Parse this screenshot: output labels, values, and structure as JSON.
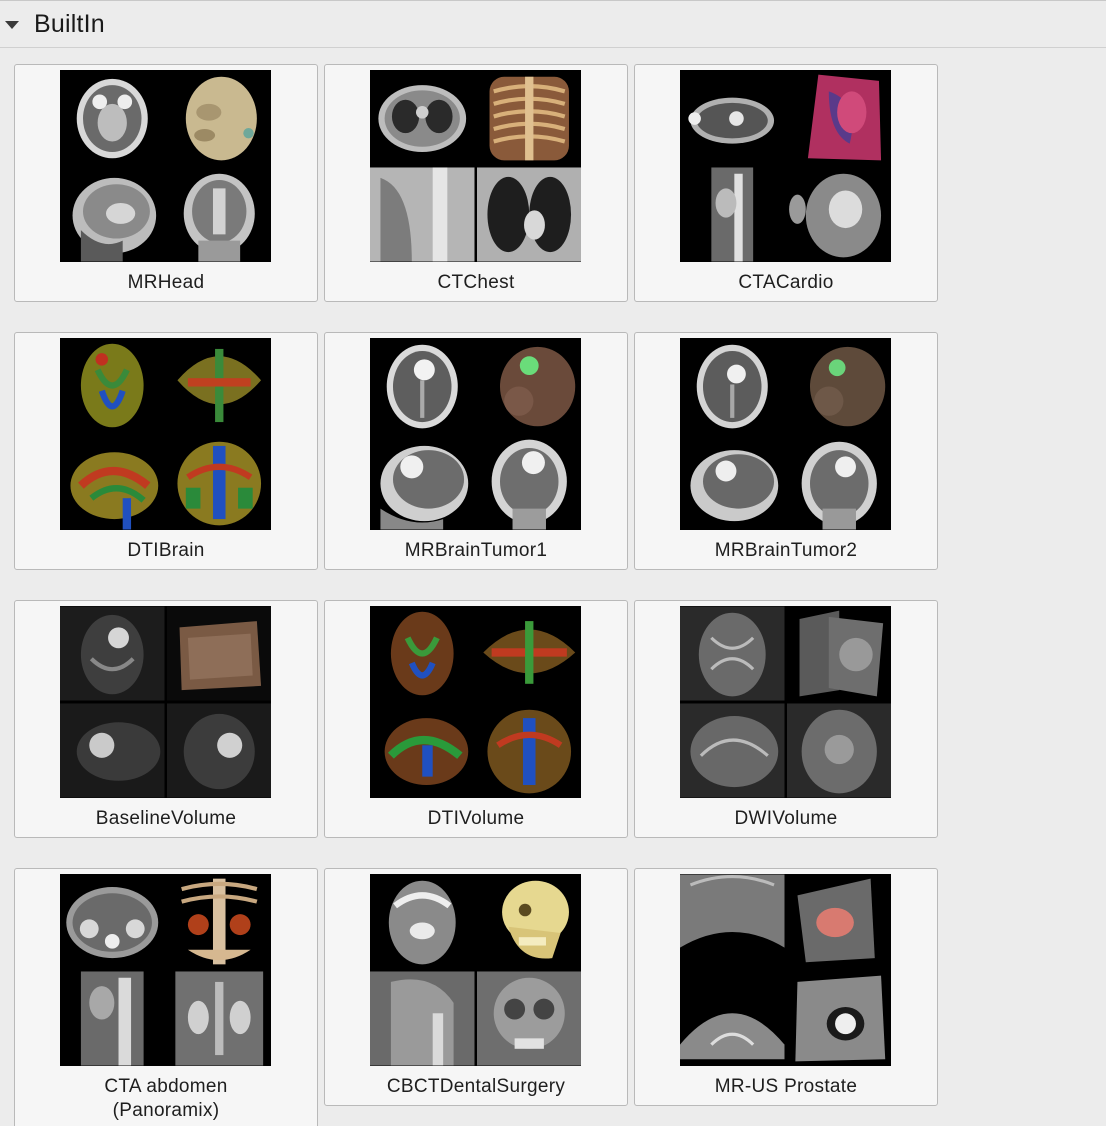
{
  "section": {
    "title": "BuiltIn",
    "collapse_icon": "disclosure-triangle-down-icon"
  },
  "datasets": [
    {
      "label": "MRHead",
      "label2": ""
    },
    {
      "label": "CTChest",
      "label2": ""
    },
    {
      "label": "CTACardio",
      "label2": ""
    },
    {
      "label": "DTIBrain",
      "label2": ""
    },
    {
      "label": "MRBrainTumor1",
      "label2": ""
    },
    {
      "label": "MRBrainTumor2",
      "label2": ""
    },
    {
      "label": "BaselineVolume",
      "label2": ""
    },
    {
      "label": "DTIVolume",
      "label2": ""
    },
    {
      "label": "DWIVolume",
      "label2": ""
    },
    {
      "label": "CTA abdomen",
      "label2": "(Panoramix)"
    },
    {
      "label": "CBCTDentalSurgery",
      "label2": ""
    },
    {
      "label": "MR-US Prostate",
      "label2": ""
    }
  ]
}
